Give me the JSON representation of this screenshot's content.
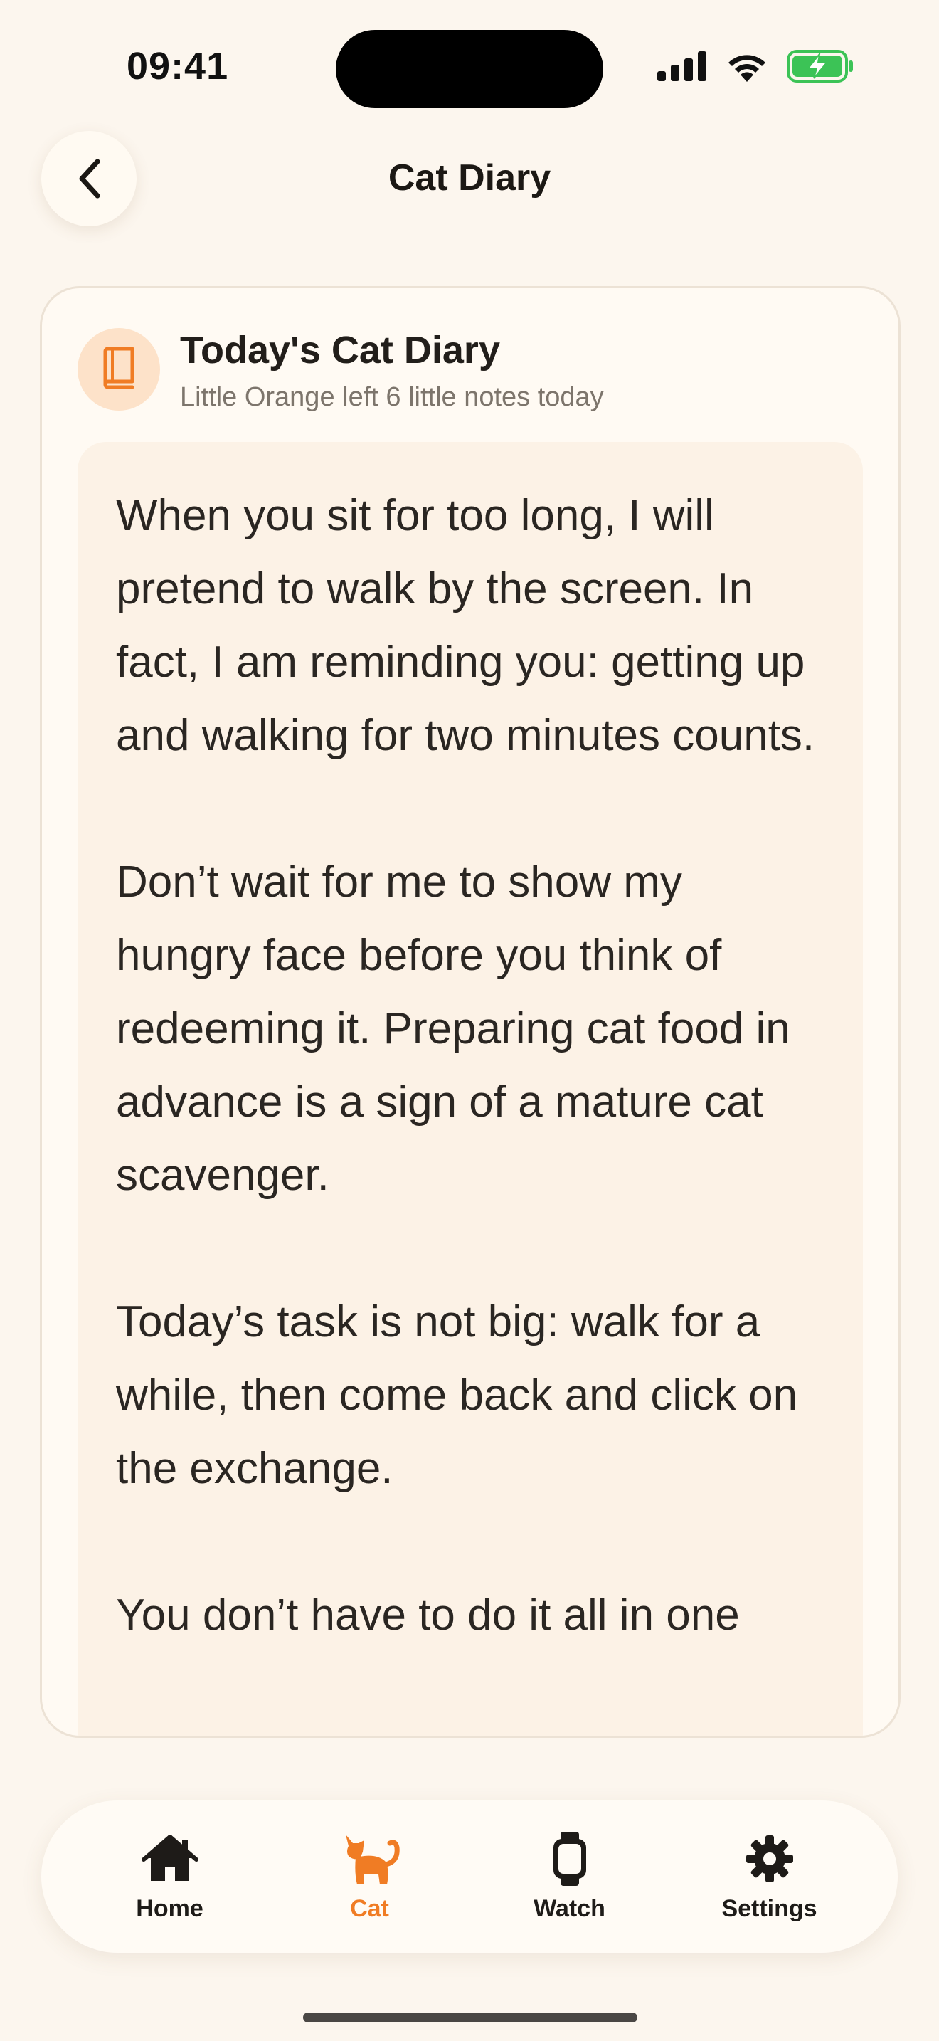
{
  "status_bar": {
    "time": "09:41",
    "icons": [
      "signal-icon",
      "wifi-icon",
      "battery-charging-icon"
    ],
    "battery_color": "#3cc356"
  },
  "header": {
    "back_icon": "chevron-left-icon",
    "title": "Cat Diary"
  },
  "diary_card": {
    "icon": "book-icon",
    "title": "Today's Cat Diary",
    "subtitle": "Little Orange left 6 little notes today",
    "entries": [
      "When you sit for too long, I will pretend to walk by the screen. In fact, I am reminding you: getting up and walking for two minutes counts.",
      "Don’t wait for me to show my hungry face before you think of redeeming it. Preparing cat food in advance is a sign of a mature cat scavenger.",
      "Today’s task is not big: walk for a while, then come back and click on the exchange.",
      "You don’t have to do it all in one"
    ]
  },
  "tab_bar": {
    "tabs": [
      {
        "label": "Home",
        "icon": "house-icon",
        "active": false
      },
      {
        "label": "Cat",
        "icon": "cat-icon",
        "active": true
      },
      {
        "label": "Watch",
        "icon": "watch-icon",
        "active": false
      },
      {
        "label": "Settings",
        "icon": "gear-icon",
        "active": false
      }
    ]
  },
  "colors": {
    "background": "#fcf6ee",
    "accent": "#f07c24",
    "card": "#fffaf3",
    "diary_box": "#fcf2e6"
  }
}
